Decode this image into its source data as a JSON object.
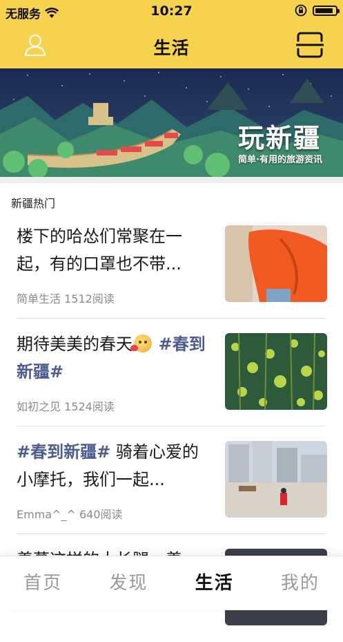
{
  "status_bar": {
    "carrier": "无服务",
    "time": "10:27",
    "battery_level": 0.9
  },
  "nav": {
    "title": "生活",
    "left_icon": "user-icon",
    "right_icon": "scan-icon"
  },
  "banner": {
    "title": "玩新疆",
    "subtitle": "简单·有用的旅游资讯"
  },
  "section": {
    "title": "新疆热门"
  },
  "feed": [
    {
      "title_parts": [
        {
          "text": "楼下的哈怂们常聚在一起，有的口罩也不带...",
          "tag": false
        }
      ],
      "meta": "简单生活 1512阅读"
    },
    {
      "title_parts": [
        {
          "text": "期待美美的春天",
          "tag": false
        },
        {
          "text": "#春到新疆#",
          "tag": true
        }
      ],
      "emoji": "blushing-face-emoji",
      "meta": "如初之见 1524阅读"
    },
    {
      "title_parts": [
        {
          "text": "#春到新疆#",
          "tag": true
        },
        {
          "text": " 骑着心爱的小摩托，我们一起...",
          "tag": false
        }
      ],
      "meta": "Emma^_^ 640阅读"
    },
    {
      "title_parts": [
        {
          "text": "羡慕这样的大长腿，羡",
          "tag": false
        }
      ],
      "meta": ""
    }
  ],
  "tabs": [
    {
      "label": "首页",
      "active": false
    },
    {
      "label": "发现",
      "active": false
    },
    {
      "label": "生活",
      "active": true
    },
    {
      "label": "我的",
      "active": false
    }
  ],
  "colors": {
    "accent": "#f7d24f",
    "tag": "#4d5d92"
  }
}
